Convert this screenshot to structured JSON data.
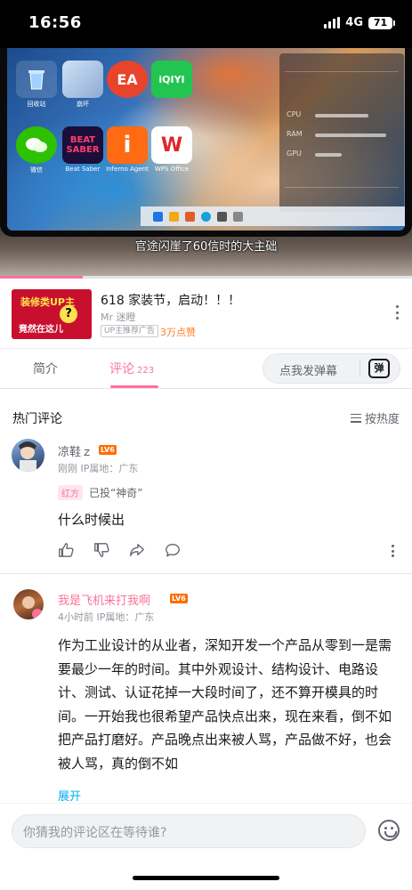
{
  "status_bar": {
    "time": "16:56",
    "network": "4G",
    "battery": "71"
  },
  "video": {
    "subtitle": "官途闪崖了60信时的大主础",
    "desktop_icons": [
      {
        "label": "回收站",
        "icon": "recycle-bin-icon"
      },
      {
        "label": "崩坏",
        "icon": "game-icon"
      },
      {
        "label": "EA",
        "icon": "ea-icon"
      },
      {
        "label": "iQIYI",
        "icon": "iqiyi-icon"
      },
      {
        "label": "微信",
        "icon": "wechat-icon"
      },
      {
        "label": "Beat Saber",
        "icon": "beatsaber-icon"
      },
      {
        "label": "Inferno Agent",
        "icon": "i-icon"
      },
      {
        "label": "WPS Office",
        "icon": "wps-icon"
      }
    ],
    "progress_fraction": 0.2,
    "colors": {
      "progress": "#fb7299"
    }
  },
  "ad": {
    "thumb_top": "装修类UP主",
    "thumb_bottom": "竟然在这儿",
    "title": "618 家装节，启动！！！",
    "author": "Mr 迷瞪",
    "tag": "UP主推荐广告",
    "likes": "3万点赞"
  },
  "tabs": {
    "intro": "简介",
    "comments": "评论",
    "comment_count": "223",
    "danmaku_placeholder": "点我发弹幕",
    "danmaku_icon": "弹"
  },
  "hot": {
    "title": "热门评论",
    "sort": "按热度"
  },
  "comments": [
    {
      "username": "凉鞋ｚ",
      "level": "LV6",
      "meta": "刚刚  IP属地：广东",
      "vote_tag": "红方",
      "vote_text": "已投“神奇”",
      "text": "什么时候出"
    },
    {
      "username": "我是飞机来打我啊",
      "level": "LV6",
      "meta": "4小时前  IP属地：广东",
      "text": "作为工业设计的从业者，深知开发一个产品从零到一是需要最少一年的时间。其中外观设计、结构设计、电路设计、测试、认证花掉一大段时间了，还不算开模具的时间。一开始我也很希望产品快点出来，现在来看，倒不如把产品打磨好。产品晚点出来被人骂，产品做不好，也会被人骂，真的倒不如",
      "expand": "展开"
    }
  ],
  "input": {
    "placeholder": "你猜我的评论区在等待谁?"
  }
}
